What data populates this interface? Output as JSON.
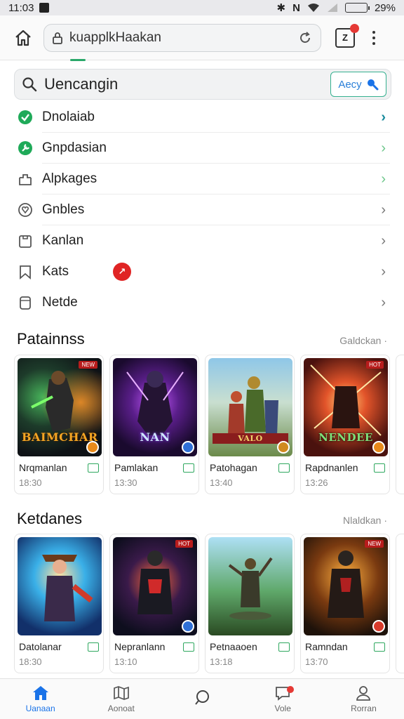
{
  "status_bar": {
    "time": "11:03",
    "battery": "29%"
  },
  "browser": {
    "url": "kuapplkHaakan"
  },
  "search": {
    "label": "Uencangin",
    "button_label": "Aecy"
  },
  "menu": [
    {
      "label": "Dnolaiab",
      "icon": "check-circle-icon",
      "icon_color": "#1faa59",
      "chevron_color": "#188a9c"
    },
    {
      "label": "Gnpdasian",
      "icon": "wrench-circle-icon",
      "icon_color": "#1faa59",
      "chevron_color": "#6cc68a"
    },
    {
      "label": "Alpkages",
      "icon": "package-icon",
      "icon_color": "#555555",
      "chevron_color": "#6cc68a"
    },
    {
      "label": "Gnbles",
      "icon": "heart-circle-icon",
      "icon_color": "#555555",
      "chevron_color": "#777777"
    },
    {
      "label": "Kanlan",
      "icon": "clipboard-icon",
      "icon_color": "#555555",
      "chevron_color": "#777777"
    },
    {
      "label": "Kats",
      "icon": "bookmark-icon",
      "icon_color": "#555555",
      "chevron_color": "#777777"
    },
    {
      "label": "Netde",
      "icon": "document-icon",
      "icon_color": "#555555",
      "chevron_color": "#777777"
    }
  ],
  "section1": {
    "title": "Patainnss",
    "more": "Galdckan ·",
    "cards": [
      {
        "name": "Nrqmanlan",
        "time": "18:30",
        "art_title": "BAIMCHAR"
      },
      {
        "name": "Pamlakan",
        "time": "13:30",
        "art_title": "NAN"
      },
      {
        "name": "Patohagan",
        "time": "13:40",
        "art_title": "VALO"
      },
      {
        "name": "Rapdnanlen",
        "time": "13:26",
        "art_title": "NENDEE"
      }
    ]
  },
  "section2": {
    "title": "Ketdanes",
    "more": "Nlaldkan ·",
    "cards": [
      {
        "name": "Datolanar",
        "time": "18:30"
      },
      {
        "name": "Nepranlann",
        "time": "13:10"
      },
      {
        "name": "Petnaaoen",
        "time": "13:18"
      },
      {
        "name": "Ramndan",
        "time": "13:70"
      }
    ]
  },
  "bottom_nav": [
    {
      "label": "Uanaan",
      "icon": "home-icon",
      "active": true
    },
    {
      "label": "Aonoat",
      "icon": "map-icon",
      "active": false
    },
    {
      "label": "",
      "icon": "chat-bubble-icon",
      "active": false
    },
    {
      "label": "Vole",
      "icon": "message-icon",
      "active": false
    },
    {
      "label": "Rorran",
      "icon": "profile-icon",
      "active": false
    }
  ]
}
